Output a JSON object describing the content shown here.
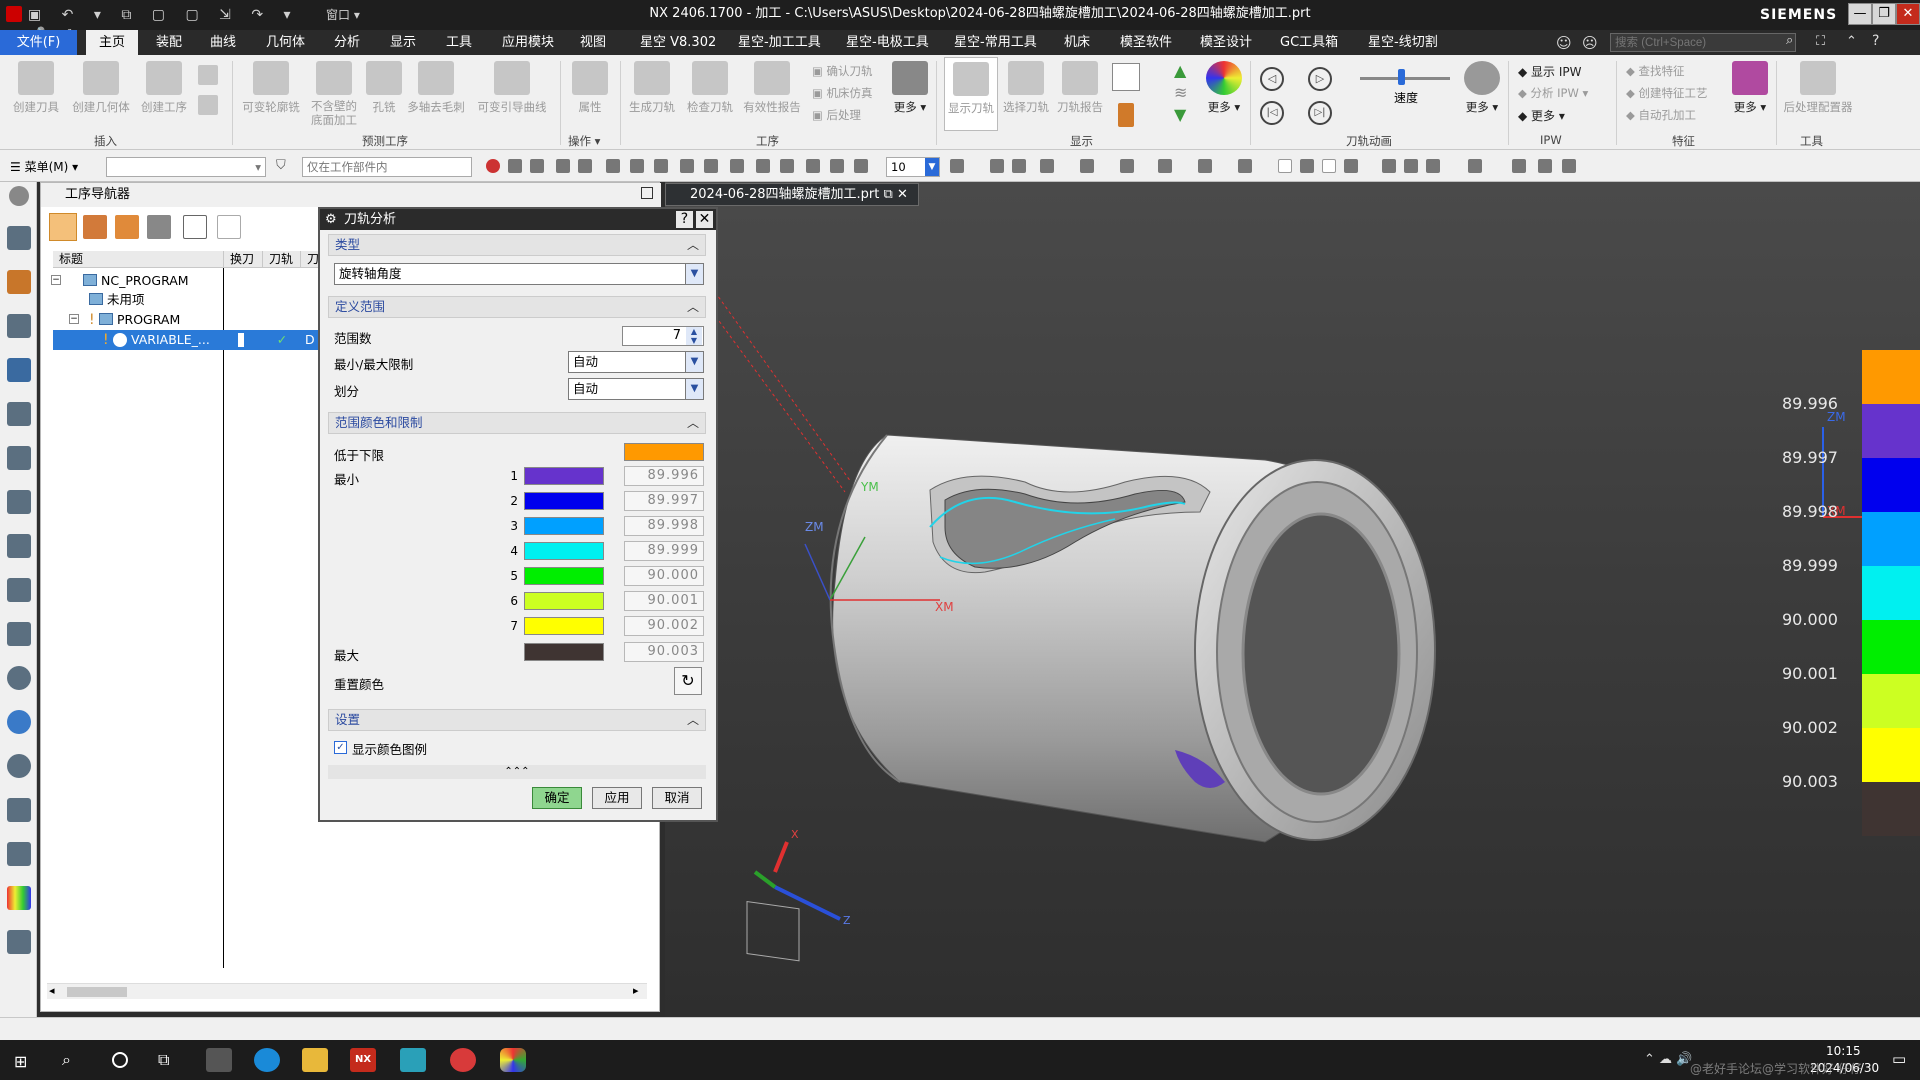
{
  "titlebar": {
    "title": "NX 2406.1700 - 加工 - C:\\Users\\ASUS\\Desktop\\2024-06-28四轴螺旋槽加工\\2024-06-28四轴螺旋槽加工.prt",
    "brand": "SIEMENS",
    "window_menu": "窗口"
  },
  "menu": {
    "file": "文件(F)",
    "tabs": [
      "主页",
      "装配",
      "曲线",
      "几何体",
      "分析",
      "显示",
      "工具",
      "应用模块",
      "视图",
      "星空 V8.302",
      "星空-加工工具",
      "星空-电极工具",
      "星空-常用工具",
      "机床",
      "模圣软件",
      "模圣设计",
      "GC工具箱",
      "星空-线切割"
    ],
    "search_placeholder": "搜索 (Ctrl+Space)"
  },
  "ribbon": {
    "insert": {
      "items": [
        "创建刀具",
        "创建几何体",
        "创建工序"
      ],
      "group": "插入"
    },
    "predefined": {
      "items": [
        "可变轮廓铣",
        "不含壁的底面加工",
        "孔铣",
        "多轴去毛刺",
        "可变引导曲线"
      ],
      "group": "预测工序"
    },
    "ops": {
      "items": [
        "属性"
      ],
      "group": "操作"
    },
    "process": {
      "items": [
        "生成刀轨",
        "检查刀轨",
        "有效性报告"
      ],
      "small": [
        "确认刀轨",
        "机床仿真",
        "后处理"
      ],
      "more": "更多",
      "group": "工序"
    },
    "display": {
      "items": [
        "显示刀轨",
        "选择刀轨",
        "刀轨报告"
      ],
      "more": "更多",
      "group": "显示"
    },
    "animation": {
      "speed": "速度",
      "group": "刀轨动画",
      "more": "更多"
    },
    "ipw": {
      "small": [
        "显示 IPW",
        "分析 IPW",
        "更多"
      ],
      "group": "IPW"
    },
    "feature": {
      "small": [
        "查找特征",
        "创建特征工艺",
        "自动孔加工"
      ],
      "more": "更多",
      "group": "特征"
    },
    "tools": {
      "items": [
        "后处理配置器"
      ],
      "group": "工具"
    }
  },
  "toolbar2": {
    "menu": "菜单(M)",
    "filter": "仅在工作部件内",
    "value": "10"
  },
  "navigator": {
    "title": "工序导航器",
    "columns": [
      "标题",
      "换刀",
      "刀轨",
      "刀"
    ],
    "rows": [
      {
        "label": "NC_PROGRAM",
        "level": 0
      },
      {
        "label": "未用项",
        "level": 1
      },
      {
        "label": "PROGRAM",
        "level": 1
      },
      {
        "label": "VARIABLE_...",
        "level": 2,
        "selected": true,
        "col3": "D"
      }
    ]
  },
  "dialog": {
    "title": "刀轨分析",
    "type_section": "类型",
    "type_value": "旋转轴角度",
    "range_section": "定义范围",
    "range_count_label": "范围数",
    "range_count": "7",
    "minmax_label": "最小/最大限制",
    "minmax_value": "自动",
    "division_label": "划分",
    "division_value": "自动",
    "color_section": "范围颜色和限制",
    "below_label": "低于下限",
    "below_color": "#ff9900",
    "min_label": "最小",
    "max_label": "最大",
    "ranges": [
      {
        "n": "1",
        "color": "#6633cc",
        "value": "89.996"
      },
      {
        "n": "2",
        "color": "#0000ee",
        "value": "89.997"
      },
      {
        "n": "3",
        "color": "#00a0ff",
        "value": "89.998"
      },
      {
        "n": "4",
        "color": "#00f0f0",
        "value": "89.999"
      },
      {
        "n": "5",
        "color": "#00ee00",
        "value": "90.000"
      },
      {
        "n": "6",
        "color": "#ccff22",
        "value": "90.001"
      },
      {
        "n": "7",
        "color": "#ffff00",
        "value": "90.002"
      }
    ],
    "max_color": "#3f3432",
    "max_value": "90.003",
    "reset_label": "重置颜色",
    "settings_section": "设置",
    "show_legend_label": "显示颜色图例",
    "ok": "确定",
    "apply": "应用",
    "cancel": "取消"
  },
  "viewport": {
    "tab": "2024-06-28四轴螺旋槽加工.prt",
    "axes": {
      "ym": "YM",
      "zm": "ZM",
      "xm": "XM",
      "tx": "X",
      "tz": "Z"
    },
    "legend": [
      {
        "label": "89.996",
        "color": "#ff9900"
      },
      {
        "label": "89.997",
        "color": "#6633cc"
      },
      {
        "label": "89.998",
        "color": "#0000ee"
      },
      {
        "label": "89.999",
        "color": "#00a0ff"
      },
      {
        "label": "90.000",
        "color": "#00f0f0"
      },
      {
        "label": "90.001",
        "color": "#00ee00"
      },
      {
        "label": "90.002",
        "color": "#ccff22"
      },
      {
        "label": "90.003",
        "color": "#ffff00"
      },
      {
        "label": "",
        "color": "#3f3432"
      }
    ]
  },
  "taskbar": {
    "time": "10:15",
    "date": "2024/06/30",
    "watermark": "@老好手论坛@学习软件好 仔仔"
  }
}
